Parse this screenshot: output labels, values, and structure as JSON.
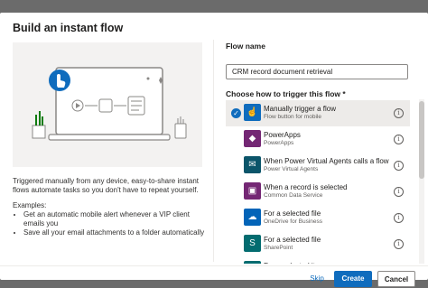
{
  "dialog": {
    "title": "Build an instant flow",
    "description": "Triggered manually from any device, easy-to-share instant flows automate tasks so you don't have to repeat yourself.",
    "examples_heading": "Examples:",
    "examples": [
      "Get an automatic mobile alert whenever a VIP client emails you",
      "Save all your email attachments to a folder automatically"
    ],
    "flow_name_label": "Flow name",
    "flow_name_value": "CRM record document retrieval",
    "trigger_label": "Choose how to trigger this flow *",
    "triggers": [
      {
        "name": "Manually trigger a flow",
        "sub": "Flow button for mobile",
        "icon": "touch-button-icon",
        "color": "#0f6cbd",
        "selected": true
      },
      {
        "name": "PowerApps",
        "sub": "PowerApps",
        "icon": "powerapps-icon",
        "color": "#742774",
        "selected": false
      },
      {
        "name": "When Power Virtual Agents calls a flow",
        "sub": "Power Virtual Agents",
        "icon": "chatbot-icon",
        "color": "#0b556a",
        "selected": false
      },
      {
        "name": "When a record is selected",
        "sub": "Common Data Service",
        "icon": "database-icon",
        "color": "#742774",
        "selected": false
      },
      {
        "name": "For a selected file",
        "sub": "OneDrive for Business",
        "icon": "onedrive-icon",
        "color": "#0364b8",
        "selected": false
      },
      {
        "name": "For a selected file",
        "sub": "SharePoint",
        "icon": "sharepoint-icon",
        "color": "#036c70",
        "selected": false
      },
      {
        "name": "For a selected item",
        "sub": "",
        "icon": "sharepoint-icon",
        "color": "#036c70",
        "selected": false
      }
    ],
    "buttons": {
      "skip": "Skip",
      "create": "Create",
      "cancel": "Cancel"
    }
  }
}
